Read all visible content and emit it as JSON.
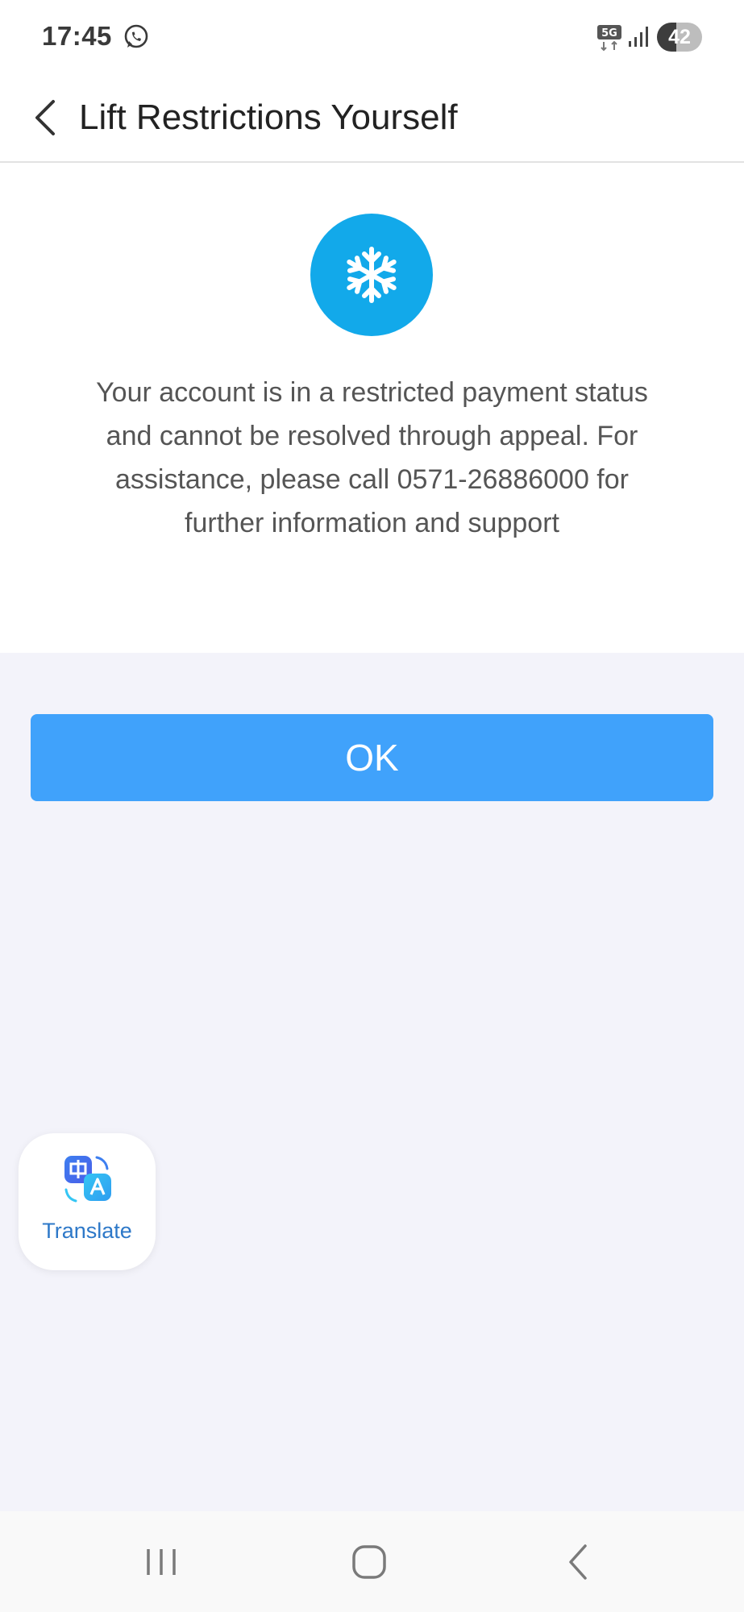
{
  "status_bar": {
    "time": "17:45",
    "network": "5G",
    "battery": "42",
    "notification_icon": "whatsapp-icon"
  },
  "header": {
    "title": "Lift Restrictions Yourself",
    "back_icon": "chevron-left-icon"
  },
  "info": {
    "icon": "snowflake-icon",
    "message": "Your account is in a restricted payment status and cannot be resolved through appeal. For assistance, please call 0571-26886000 for further information and support"
  },
  "actions": {
    "ok_label": "OK"
  },
  "translate_widget": {
    "label": "Translate",
    "icon": "translate-icon"
  },
  "nav_bar": {
    "items": [
      "recent-apps-icon",
      "home-icon",
      "back-icon"
    ]
  },
  "colors": {
    "accent": "#12a9ea",
    "button": "#40a2fb",
    "background": "#f3f3fa",
    "translate_text": "#2d78c8"
  }
}
